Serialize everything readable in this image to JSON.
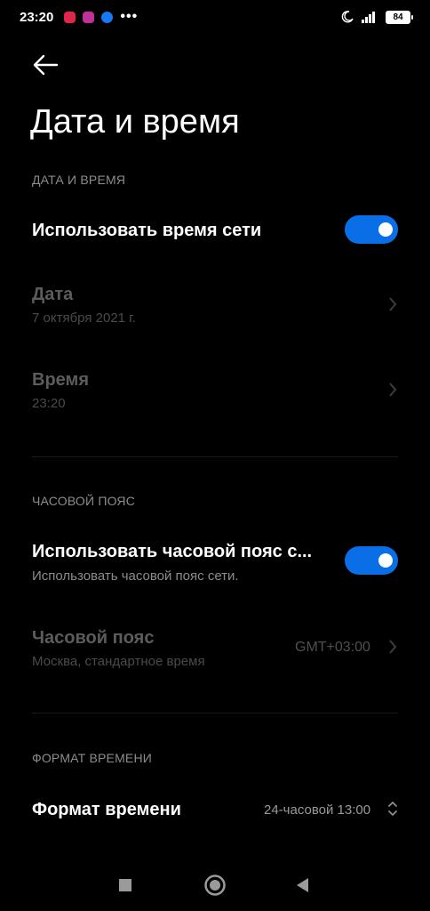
{
  "status_bar": {
    "time": "23:20",
    "battery": "84",
    "icons": [
      "notification-app-icon",
      "instagram-icon",
      "facebook-icon",
      "more-notifications-icon",
      "moon-icon",
      "signal-icon",
      "battery-icon"
    ],
    "more": "•••"
  },
  "header": {
    "back_icon": "arrow-left-icon",
    "title": "Дата и время"
  },
  "sections": {
    "date_time": {
      "header": "ДАТА И ВРЕМЯ",
      "network_time": {
        "label": "Использовать время сети",
        "enabled": true
      },
      "date": {
        "label": "Дата",
        "value": "7 октября 2021 г."
      },
      "time": {
        "label": "Время",
        "value": "23:20"
      }
    },
    "time_zone": {
      "header": "ЧАСОВОЙ ПОЯС",
      "network_tz": {
        "label": "Использовать часовой пояс с...",
        "summary": "Использовать часовой пояс сети.",
        "enabled": true
      },
      "tz": {
        "label": "Часовой пояс",
        "summary": "Москва, стандартное время",
        "value": "GMT+03:00"
      }
    },
    "time_format": {
      "header": "ФОРМАТ ВРЕМЕНИ",
      "format": {
        "label": "Формат времени",
        "value": "24-часовой 13:00"
      }
    }
  },
  "colors": {
    "accent": "#0a6ee6",
    "background": "#000000",
    "disabled_text": "#5c5c5c",
    "secondary_text": "#8c8c8c"
  },
  "nav": {
    "icons": [
      "recents-square-icon",
      "home-circle-icon",
      "back-triangle-icon"
    ]
  }
}
